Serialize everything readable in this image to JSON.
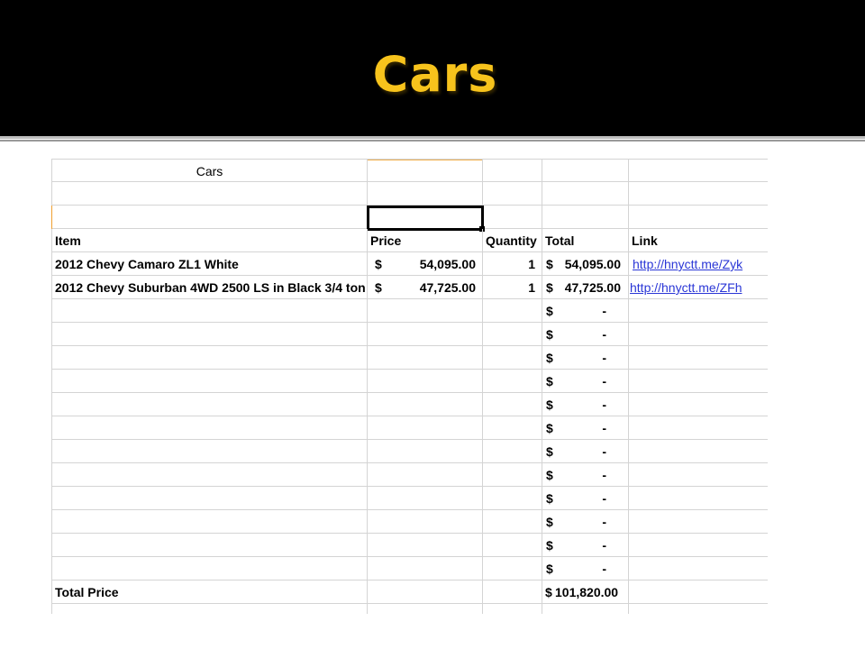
{
  "slide": {
    "title": "Cars",
    "title_color": "#f7c31c",
    "background": "#000000"
  },
  "sheet": {
    "caption": "Cars",
    "headers": [
      "Item",
      "Price",
      "Quantity",
      "Total",
      "Link"
    ],
    "rows": [
      {
        "item": "2012 Chevy Camaro ZL1 White",
        "price_symbol": "$",
        "price": "54,095.00",
        "quantity": "1",
        "total_symbol": "$",
        "total": "54,095.00",
        "link": "http://hnyctt.me/Zyk"
      },
      {
        "item": "2012 Chevy Suburban 4WD 2500 LS in Black 3/4 ton",
        "price_symbol": "$",
        "price": "47,725.00",
        "quantity": "1",
        "total_symbol": "$",
        "total": "47,725.00",
        "link": "http://hnyctt.me/ZFh"
      }
    ],
    "empty_total_symbol": "$",
    "empty_total_value": "-",
    "empty_row_count": 12,
    "footer_label": "Total Price",
    "footer_symbol": "$",
    "footer_total": "101,820.00",
    "link_color": "#2a36d6"
  }
}
